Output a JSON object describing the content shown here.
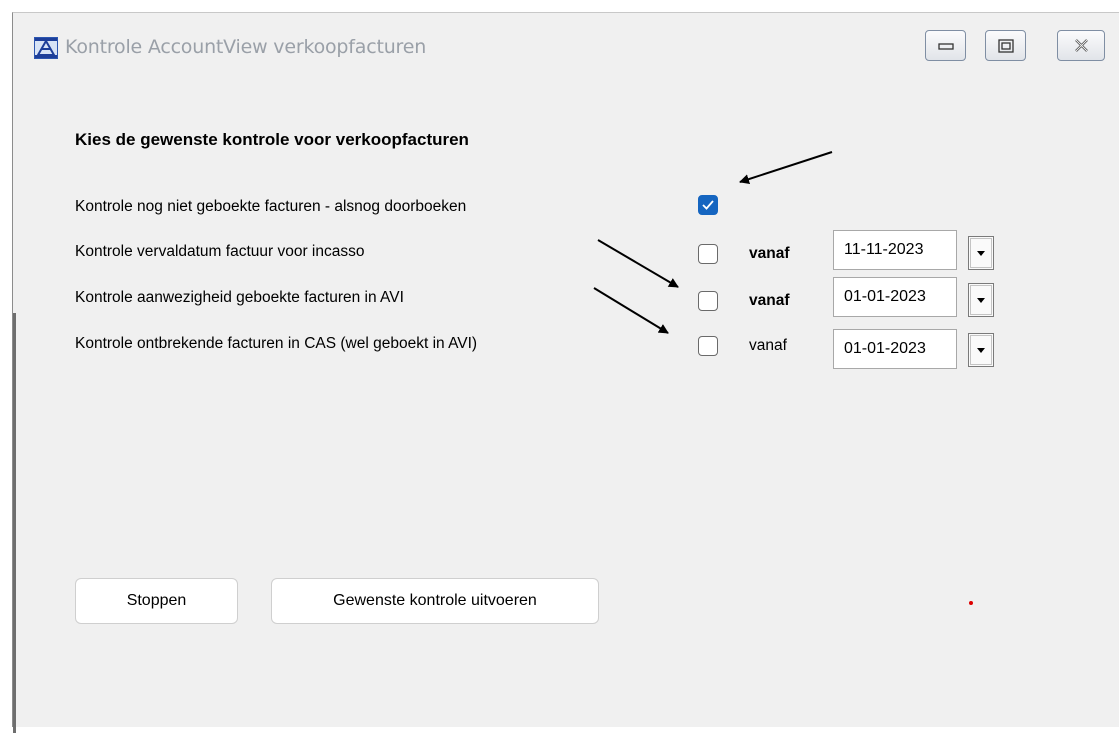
{
  "window": {
    "title": "Kontrole AccountView verkoopfacturen",
    "icon": "app-icon",
    "controls": [
      "minimize-icon",
      "maximize-icon",
      "close-icon"
    ]
  },
  "heading": "Kies de gewenste kontrole voor verkoopfacturen",
  "rows": [
    {
      "label": "Kontrole nog niet geboekte facturen - alsnog doorboeken",
      "checked": true
    },
    {
      "label": "Kontrole vervaldatum factuur voor incasso",
      "checked": false,
      "vanaf": "vanaf",
      "date": "11-11-2023"
    },
    {
      "label": "Kontrole aanwezigheid geboekte facturen in AVI",
      "checked": false,
      "vanaf": "vanaf",
      "date": "01-01-2023"
    },
    {
      "label": "Kontrole ontbrekende facturen in CAS (wel geboekt in AVI)",
      "checked": false,
      "vanaf": "vanaf",
      "date": "01-01-2023"
    }
  ],
  "buttons": {
    "stop": "Stoppen",
    "run": "Gewenste kontrole uitvoeren"
  },
  "colors": {
    "accent": "#1565c0",
    "background": "#f0f0f0",
    "annotation": "#000000"
  }
}
